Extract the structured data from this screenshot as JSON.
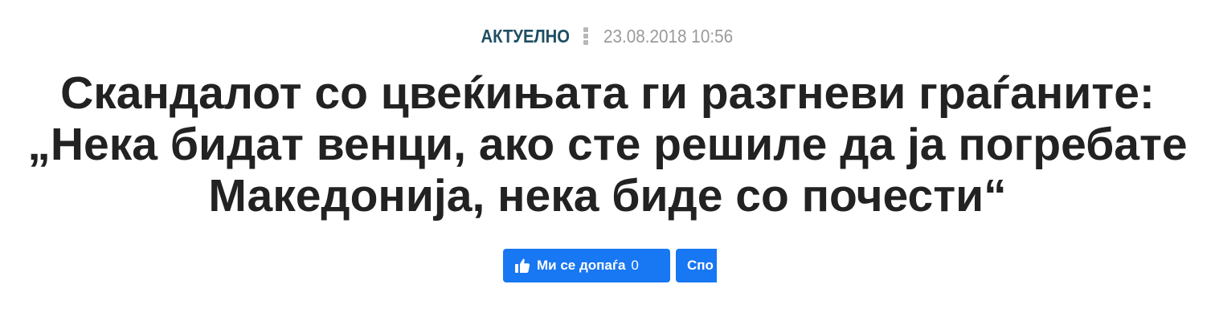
{
  "meta": {
    "category": "АКТУЕЛНО",
    "date": "23.08.2018 10:56"
  },
  "headline": {
    "lines": [
      "Скандалот со цвеќињата ги разгневи граѓаните:",
      "„Нека бидат венци, ако сте решиле да ја погребате",
      "Македонија, нека биде со почести“"
    ]
  },
  "social": {
    "like_label": "Ми се допаѓа",
    "like_count": "0",
    "share_label_visible": "Спо"
  },
  "colors": {
    "category": "#1f4f63",
    "date": "#9a9a9a",
    "headline": "#222222",
    "facebook_blue": "#1877f2"
  },
  "icons": {
    "like": "thumbs-up-icon",
    "separator": "vertical-dots-icon"
  }
}
